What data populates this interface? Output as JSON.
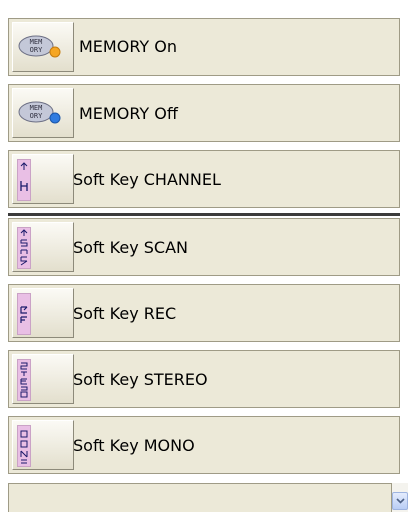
{
  "items": [
    {
      "label": "MEMORY On",
      "icon": "memory-on-icon",
      "badge_color": "#f5a623"
    },
    {
      "label": "MEMORY Off",
      "icon": "memory-off-icon",
      "badge_color": "#2f7be0"
    },
    {
      "label": "Soft Key CHANNEL",
      "icon": "channel-key-icon"
    },
    {
      "label": "Soft Key SCAN",
      "icon": "scan-key-icon"
    },
    {
      "label": "Soft Key REC",
      "icon": "rec-key-icon"
    },
    {
      "label": "Soft Key STEREO",
      "icon": "stereo-key-icon"
    },
    {
      "label": "Soft Key MONO",
      "icon": "mono-key-icon"
    }
  ],
  "colors": {
    "row_bg": "#ece9d8",
    "tag_bg": "#e9bfe5",
    "scrollbar": "#b9cdf5"
  }
}
